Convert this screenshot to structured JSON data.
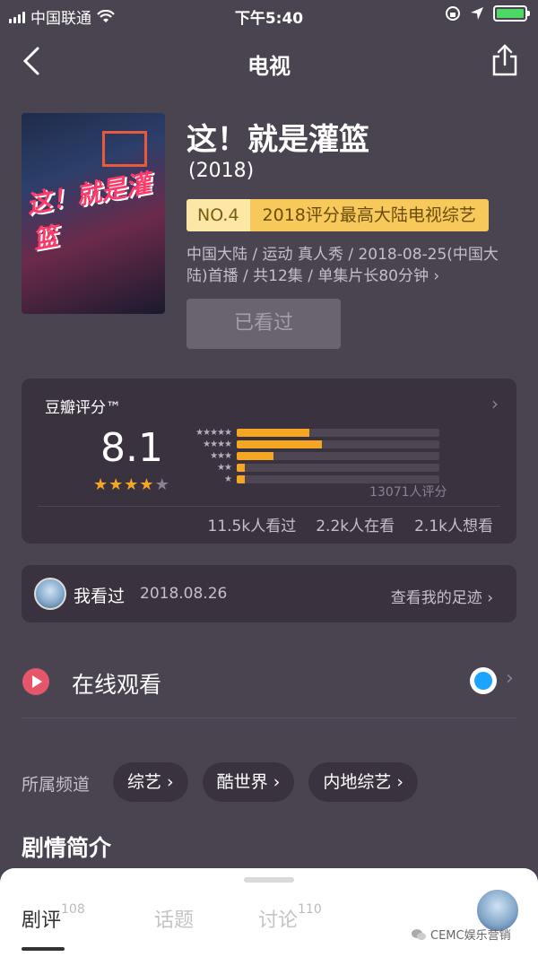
{
  "status_bar": {
    "carrier": "中国联通",
    "time": "下午5:40"
  },
  "nav": {
    "title": "电视"
  },
  "show": {
    "title": "这！就是灌篮",
    "year": "(2018)",
    "rank_no": "NO.4",
    "rank_text": "2018评分最高大陆电视综艺",
    "meta": "中国大陆 / 运动 真人秀 / 2018-08-25(中国大陆)首播 / 共12集 / 单集片长80分钟 ›",
    "watched_button": "已看过"
  },
  "rating": {
    "label": "豆瓣评分™",
    "score": "8.1",
    "stars_filled": 4,
    "distribution": [
      0.36,
      0.42,
      0.18,
      0.04,
      0.04
    ],
    "count": "13071人评分",
    "stats": [
      "11.5k人看过",
      "2.2k人在看",
      "2.1k人想看"
    ]
  },
  "seen": {
    "label": "我看过",
    "date": "2018.08.26",
    "footprint": "查看我的足迹"
  },
  "watch": {
    "label": "在线观看"
  },
  "channels": {
    "label": "所属频道",
    "items": [
      "综艺",
      "酷世界",
      "内地综艺"
    ]
  },
  "plot": {
    "title": "剧情简介"
  },
  "bottom_tabs": [
    {
      "label": "剧评",
      "count": "108"
    },
    {
      "label": "话题",
      "count": ""
    },
    {
      "label": "讨论",
      "count": "110"
    }
  ],
  "watermark": "CEMC娱乐营销"
}
